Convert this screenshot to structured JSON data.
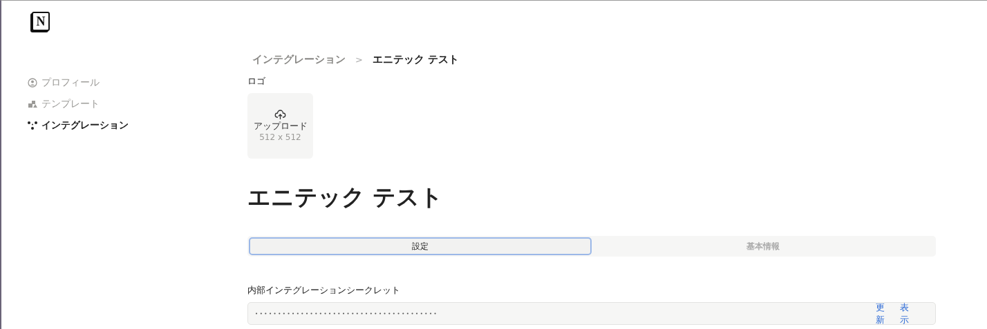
{
  "logo": {
    "letter": "N"
  },
  "sidebar": {
    "items": [
      {
        "label": "プロフィール",
        "kind": "profile",
        "selected": false
      },
      {
        "label": "テンプレート",
        "kind": "template",
        "selected": false
      },
      {
        "label": "インテグレーション",
        "kind": "integration",
        "selected": true
      }
    ]
  },
  "breadcrumb": {
    "parent": "インテグレーション",
    "separator": ">",
    "current": "エニテック テスト"
  },
  "logo_upload": {
    "label": "ロゴ",
    "button": "アップロード",
    "size": "512 x 512"
  },
  "title": "エニテック テスト",
  "tabs": [
    {
      "label": "設定",
      "selected": true
    },
    {
      "label": "基本情報",
      "selected": false
    }
  ],
  "secret": {
    "label": "内部インテグレーションシークレット",
    "value": "••••••••••••••••••••••••••••••••••••••••",
    "actions": [
      "更新",
      "表示"
    ]
  }
}
